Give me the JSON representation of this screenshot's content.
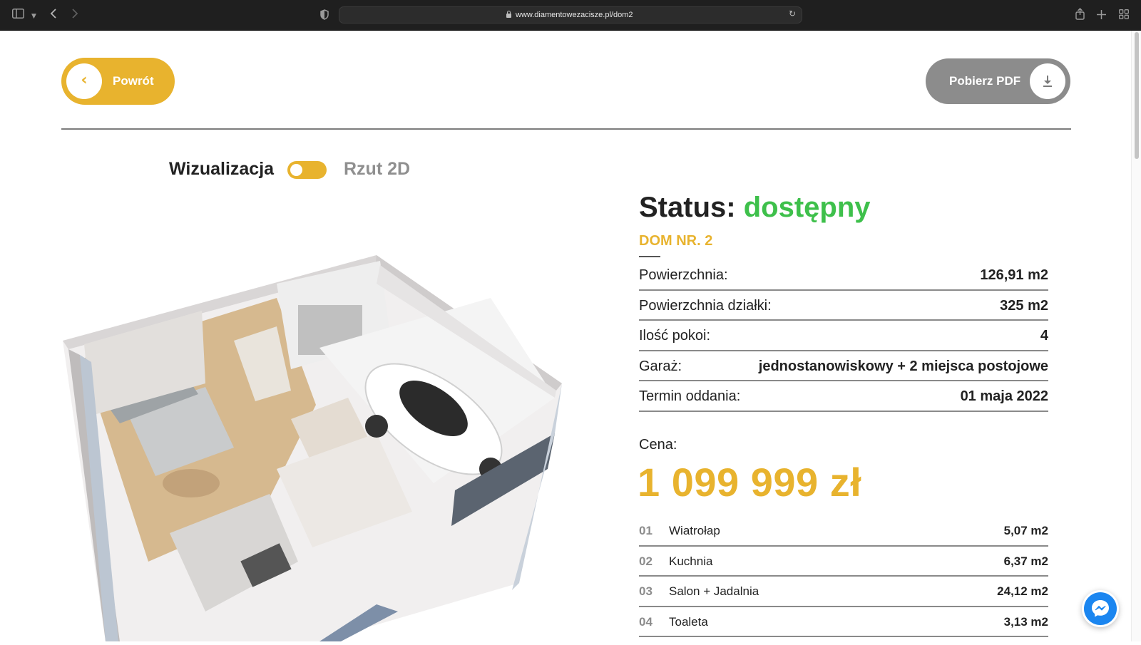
{
  "browser": {
    "url": "www.diamentowezacisze.pl/dom2",
    "icons": [
      "sidebar-icon",
      "chevron-down-icon",
      "back-arrow-icon",
      "forward-arrow-icon",
      "shield-icon",
      "lock-icon",
      "reload-icon",
      "share-icon",
      "plus-icon",
      "tabs-grid-icon"
    ]
  },
  "header": {
    "back_label": "Powrót",
    "pdf_label": "Pobierz PDF"
  },
  "view_toggle": {
    "left_label": "Wizualizacja",
    "right_label": "Rzut 2D",
    "state": "Wizualizacja"
  },
  "details": {
    "status_label": "Status:",
    "status_value": "dostępny",
    "house_number": "DOM NR. 2",
    "specs": [
      {
        "label": "Powierzchnia:",
        "value": "126,91 m2"
      },
      {
        "label": "Powierzchnia działki:",
        "value": "325 m2"
      },
      {
        "label": "Ilość pokoi:",
        "value": "4"
      },
      {
        "label": "Garaż:",
        "value": "jednostanowiskowy + 2 miejsca postojowe"
      },
      {
        "label": "Termin oddania:",
        "value": "01 maja 2022"
      }
    ],
    "price_label": "Cena:",
    "price": "1 099 999 zł",
    "rooms": [
      {
        "no": "01",
        "name": "Wiatrołap",
        "area": "5,07 m2"
      },
      {
        "no": "02",
        "name": "Kuchnia",
        "area": "6,37 m2"
      },
      {
        "no": "03",
        "name": "Salon + Jadalnia",
        "area": "24,12 m2"
      },
      {
        "no": "04",
        "name": "Toaleta",
        "area": "3,13 m2"
      }
    ]
  },
  "colors": {
    "accent": "#e8b32e",
    "status_green": "#3ec04b",
    "pdf_button": "#8c8c8c",
    "messenger_blue": "#1b86f0"
  }
}
